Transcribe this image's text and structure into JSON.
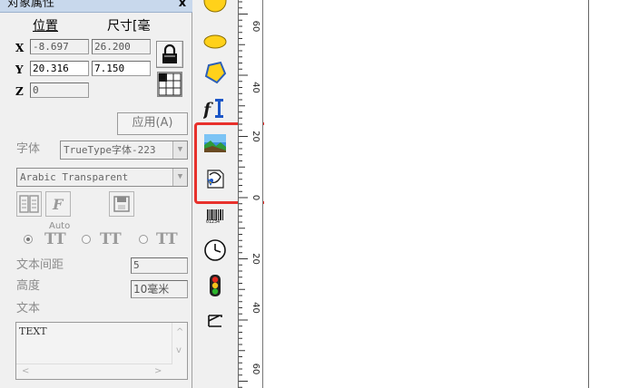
{
  "panel": {
    "title": "对象属性",
    "close_label": "x",
    "headers": {
      "position": "位置",
      "size": "尺寸[毫"
    },
    "axes": {
      "x": "X",
      "y": "Y",
      "z": "Z"
    },
    "fields": {
      "x": "-8.697",
      "y": "20.316",
      "z": "0",
      "width": "26.200",
      "height": "7.150"
    },
    "apply_label": "应用(A)",
    "font_label": "字体",
    "font_type_value": "TrueType字体-223",
    "font_name_value": "Arabic Transparent",
    "auto_label": "Auto",
    "text_spacing_label": "文本间距",
    "text_spacing_value": "5",
    "height_label": "高度",
    "height_value": "10毫米",
    "text_label": "文本",
    "text_value": "TEXT"
  },
  "toolbar": {
    "items": [
      "circle-tool",
      "ellipse-tool",
      "polygon-tool",
      "text-tool",
      "bitmap-tool",
      "vector-file-tool",
      "barcode-tool",
      "timer-tool",
      "io-port-tool",
      "extend-axis-tool"
    ],
    "barcode_digits": "01234",
    "highlight_color": "#e8312c"
  },
  "ruler": {
    "labels": [
      "60",
      "40",
      "20",
      "0",
      "20",
      "40",
      "60"
    ]
  }
}
